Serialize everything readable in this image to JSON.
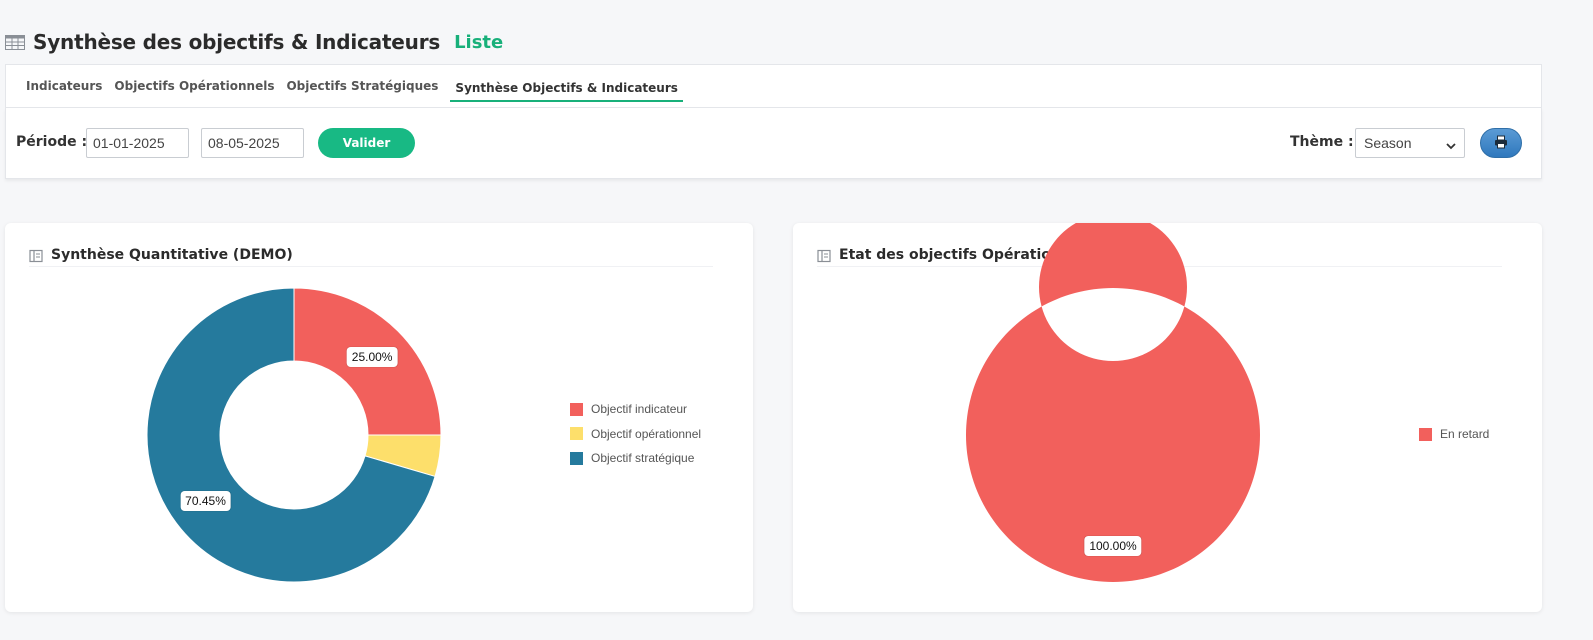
{
  "header": {
    "title": "Synthèse des objectifs & Indicateurs",
    "subtitle": "Liste",
    "icon": "table-icon"
  },
  "tabs": [
    {
      "label": "Indicateurs",
      "active": false
    },
    {
      "label": "Objectifs Opérationnels",
      "active": false
    },
    {
      "label": "Objectifs Stratégiques",
      "active": false
    },
    {
      "label": "Synthèse Objectifs & Indicateurs",
      "active": true
    }
  ],
  "filters": {
    "periode_label": "Période :",
    "date_start": "01-01-2025",
    "date_end": "08-05-2025",
    "valider_label": "Valider",
    "theme_label": "Thème :",
    "theme_value": "Season",
    "print_icon": "print-icon"
  },
  "colors": {
    "accent": "#18b984",
    "indicateur": "#f2605c",
    "operationnel": "#fddf6b",
    "strategique": "#257a9d"
  },
  "chart_data": [
    {
      "type": "pie",
      "title": "Synthèse Quantitative (DEMO)",
      "categories": [
        "Objectif indicateur",
        "Objectif opérationnel",
        "Objectif stratégique"
      ],
      "values": [
        25.0,
        4.55,
        70.45
      ],
      "data_labels": [
        "25.00%",
        "",
        "70.45%"
      ],
      "colors": [
        "#f2605c",
        "#fddf6b",
        "#257a9d"
      ],
      "donut": true,
      "legend_position": "right"
    },
    {
      "type": "pie",
      "title": "Etat des objectifs Opérationnels (DEMO)",
      "categories": [
        "En retard"
      ],
      "values": [
        100.0
      ],
      "data_labels": [
        "100.00%"
      ],
      "colors": [
        "#f2605c"
      ],
      "donut": true,
      "legend_position": "right"
    }
  ]
}
